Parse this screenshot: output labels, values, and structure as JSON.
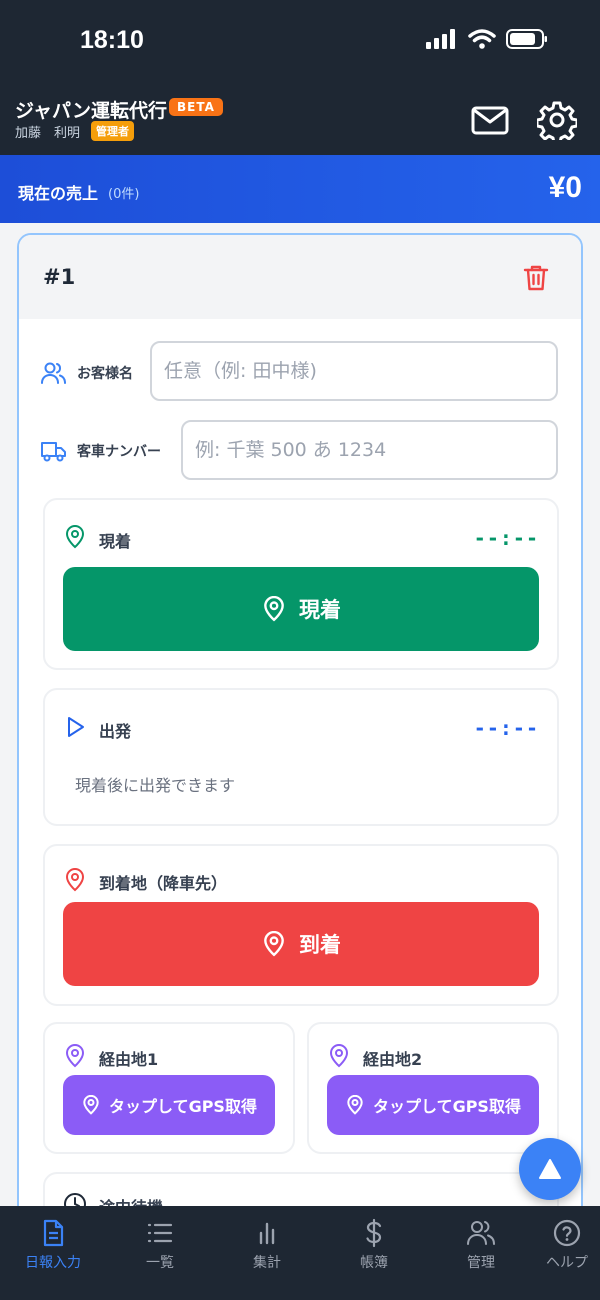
{
  "status_bar": {
    "time": "18:10"
  },
  "header": {
    "app_title": "ジャパン運転代行",
    "beta_badge": "BETA",
    "user_name": "加藤　利明",
    "role_badge": "管理者"
  },
  "sales": {
    "label": "現在の売上",
    "count": "(0件)",
    "amount": "¥0"
  },
  "card": {
    "number": "#1",
    "customer": {
      "label": "お客様名",
      "placeholder": "任意（例: 田中様)",
      "value": ""
    },
    "plate": {
      "label": "客車ナンバー",
      "placeholder": "例: 千葉 500 あ 1234",
      "value": ""
    },
    "arrival": {
      "title": "現着",
      "time": "--:--",
      "button_label": "現着",
      "color": "#059669"
    },
    "departure": {
      "title": "出発",
      "time": "--:--",
      "hint": "現着後に出発できます",
      "color": "#2563eb"
    },
    "destination": {
      "title": "到着地（降車先）",
      "button_label": "到着",
      "color": "#ef4444"
    },
    "waypoints": [
      {
        "title": "経由地1",
        "button_label": "タップしてGPS取得"
      },
      {
        "title": "経由地2",
        "button_label": "タップしてGPS取得"
      }
    ],
    "waiting": {
      "title": "途中待機"
    }
  },
  "tabs": [
    {
      "label": "日報入力",
      "icon": "document-icon",
      "active": true
    },
    {
      "label": "一覧",
      "icon": "list-icon",
      "active": false
    },
    {
      "label": "集計",
      "icon": "bar-chart-icon",
      "active": false
    },
    {
      "label": "帳簿",
      "icon": "dollar-icon",
      "active": false
    },
    {
      "label": "管理",
      "icon": "users-icon",
      "active": false
    },
    {
      "label": "ヘルプ",
      "icon": "help-icon",
      "active": false
    }
  ],
  "colors": {
    "accent": "#3b82f6",
    "header_bg": "#1e2733",
    "waypoint": "#8b5cf6"
  }
}
